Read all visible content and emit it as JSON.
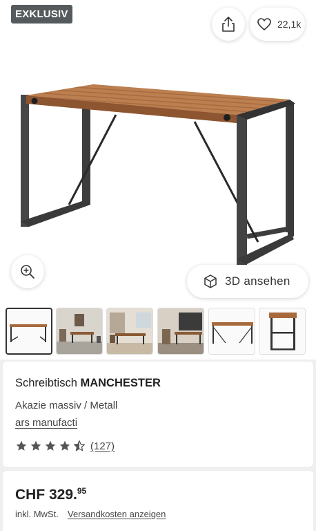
{
  "hero": {
    "badge": "EXKLUSIV",
    "like_count": "22,1k",
    "view3d_label": "3D ansehen"
  },
  "icons": {
    "share": "share-icon",
    "like": "heart-icon",
    "zoom": "zoom-in-icon",
    "view3d": "cube-icon"
  },
  "thumbnails": [
    {
      "name": "thumb-desk-front",
      "active": true
    },
    {
      "name": "thumb-room-scene-1",
      "active": false
    },
    {
      "name": "thumb-room-scene-2",
      "active": false
    },
    {
      "name": "thumb-room-scene-3",
      "active": false
    },
    {
      "name": "thumb-desk-side",
      "active": false
    },
    {
      "name": "thumb-desk-end",
      "active": false
    }
  ],
  "product": {
    "title_prefix": "Schreibtisch ",
    "title_name": "MANCHESTER",
    "material": "Akazie massiv / Metall",
    "brand": "ars manufacti",
    "rating": 4.5,
    "review_count": "(127)"
  },
  "pricing": {
    "price_main": "CHF 329.",
    "price_cents": "95",
    "tax_note": "inkl. MwSt.",
    "shipping_link": "Versandkosten anzeigen"
  },
  "colors": {
    "badge_bg": "#555b5c",
    "wood": "#a0643a",
    "metal": "#3a3a3a",
    "star": "#555555"
  }
}
